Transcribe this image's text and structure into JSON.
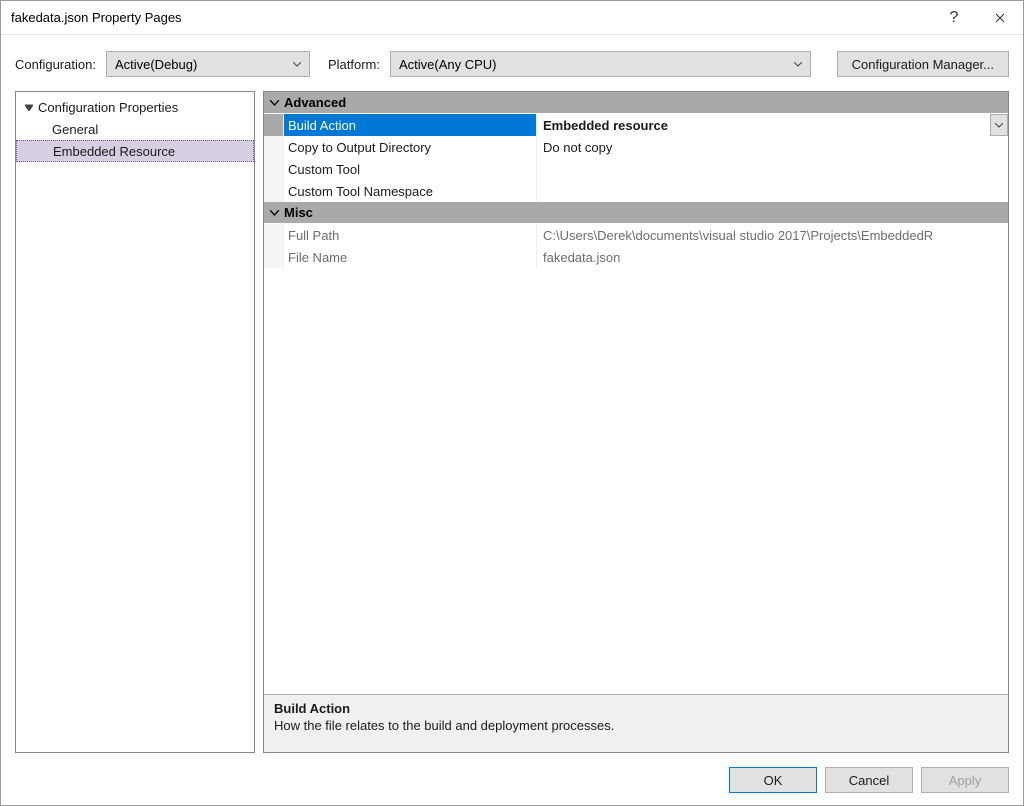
{
  "title": "fakedata.json Property Pages",
  "toolbar": {
    "configuration_label": "Configuration:",
    "configuration_value": "Active(Debug)",
    "platform_label": "Platform:",
    "platform_value": "Active(Any CPU)",
    "manager_button": "Configuration Manager..."
  },
  "tree": {
    "root": "Configuration Properties",
    "children": [
      "General",
      "Embedded Resource"
    ],
    "selected_index": 1
  },
  "grid": {
    "categories": [
      {
        "name": "Advanced",
        "rows": [
          {
            "name": "Build Action",
            "value": "Embedded resource",
            "selected": true,
            "has_dropdown": true
          },
          {
            "name": "Copy to Output Directory",
            "value": "Do not copy"
          },
          {
            "name": "Custom Tool",
            "value": ""
          },
          {
            "name": "Custom Tool Namespace",
            "value": ""
          }
        ]
      },
      {
        "name": "Misc",
        "rows": [
          {
            "name": "Full Path",
            "value": "C:\\Users\\Derek\\documents\\visual studio 2017\\Projects\\EmbeddedR",
            "disabled": true
          },
          {
            "name": "File Name",
            "value": "fakedata.json",
            "disabled": true
          }
        ]
      }
    ]
  },
  "description": {
    "title": "Build Action",
    "text": "How the file relates to the build and deployment processes."
  },
  "buttons": {
    "ok": "OK",
    "cancel": "Cancel",
    "apply": "Apply"
  }
}
